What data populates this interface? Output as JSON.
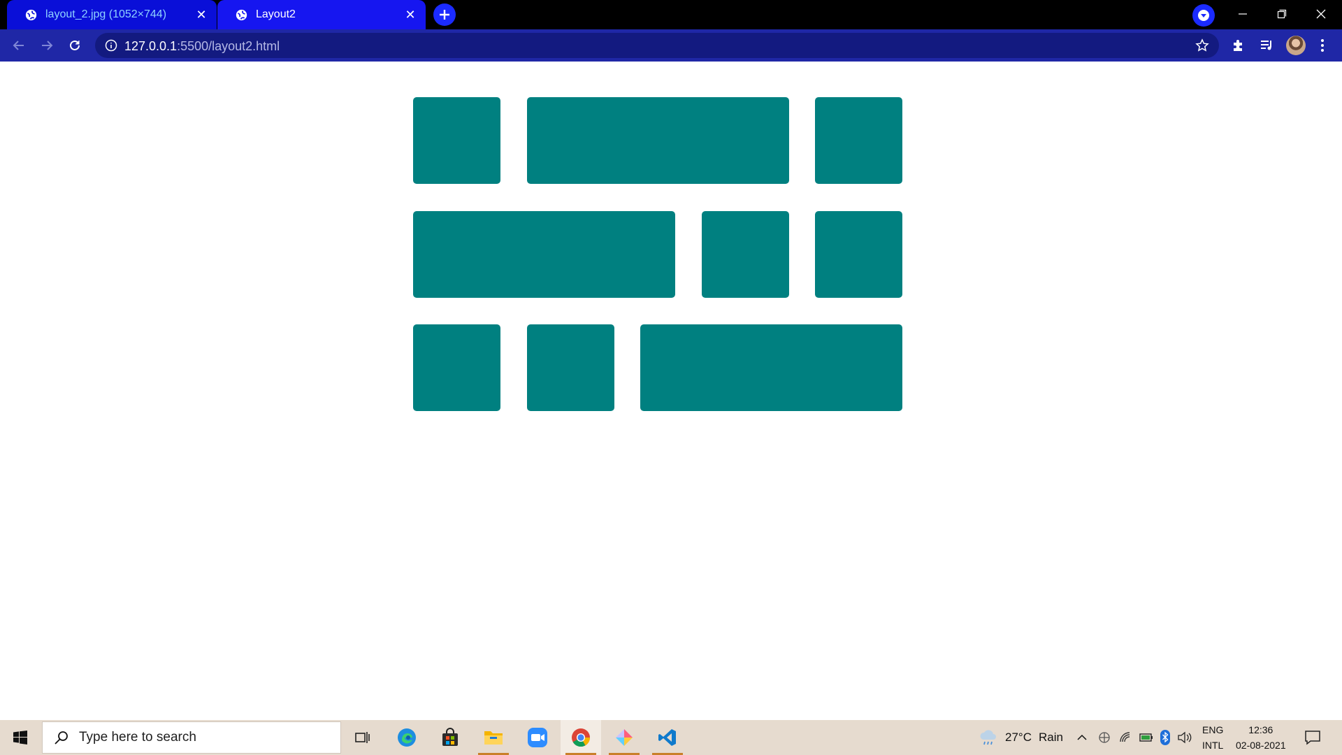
{
  "browser": {
    "tabs": [
      {
        "title": "layout_2.jpg (1052×744)",
        "active": false
      },
      {
        "title": "Layout2",
        "active": true
      }
    ],
    "address": {
      "host": "127.0.0.1",
      "rest": ":5500/layout2.html"
    },
    "colors": {
      "tabstrip": "#000000",
      "toolbar": "#1f27a6",
      "active_tab": "#1616f0",
      "inactive_tab": "#0a0fd8"
    }
  },
  "page": {
    "block_color": "#008080",
    "rows": [
      [
        "small",
        "wide",
        "small"
      ],
      [
        "wide",
        "small",
        "small"
      ],
      [
        "small",
        "small",
        "wide"
      ]
    ]
  },
  "taskbar": {
    "search_placeholder": "Type here to search",
    "apps": [
      "task-view",
      "edge",
      "store",
      "file-explorer",
      "zoom",
      "chrome",
      "paint-3d",
      "vscode"
    ],
    "weather": {
      "temp": "27°C",
      "condition": "Rain"
    },
    "language": {
      "line1": "ENG",
      "line2": "INTL"
    },
    "clock": {
      "time": "12:36",
      "date": "02-08-2021"
    }
  }
}
